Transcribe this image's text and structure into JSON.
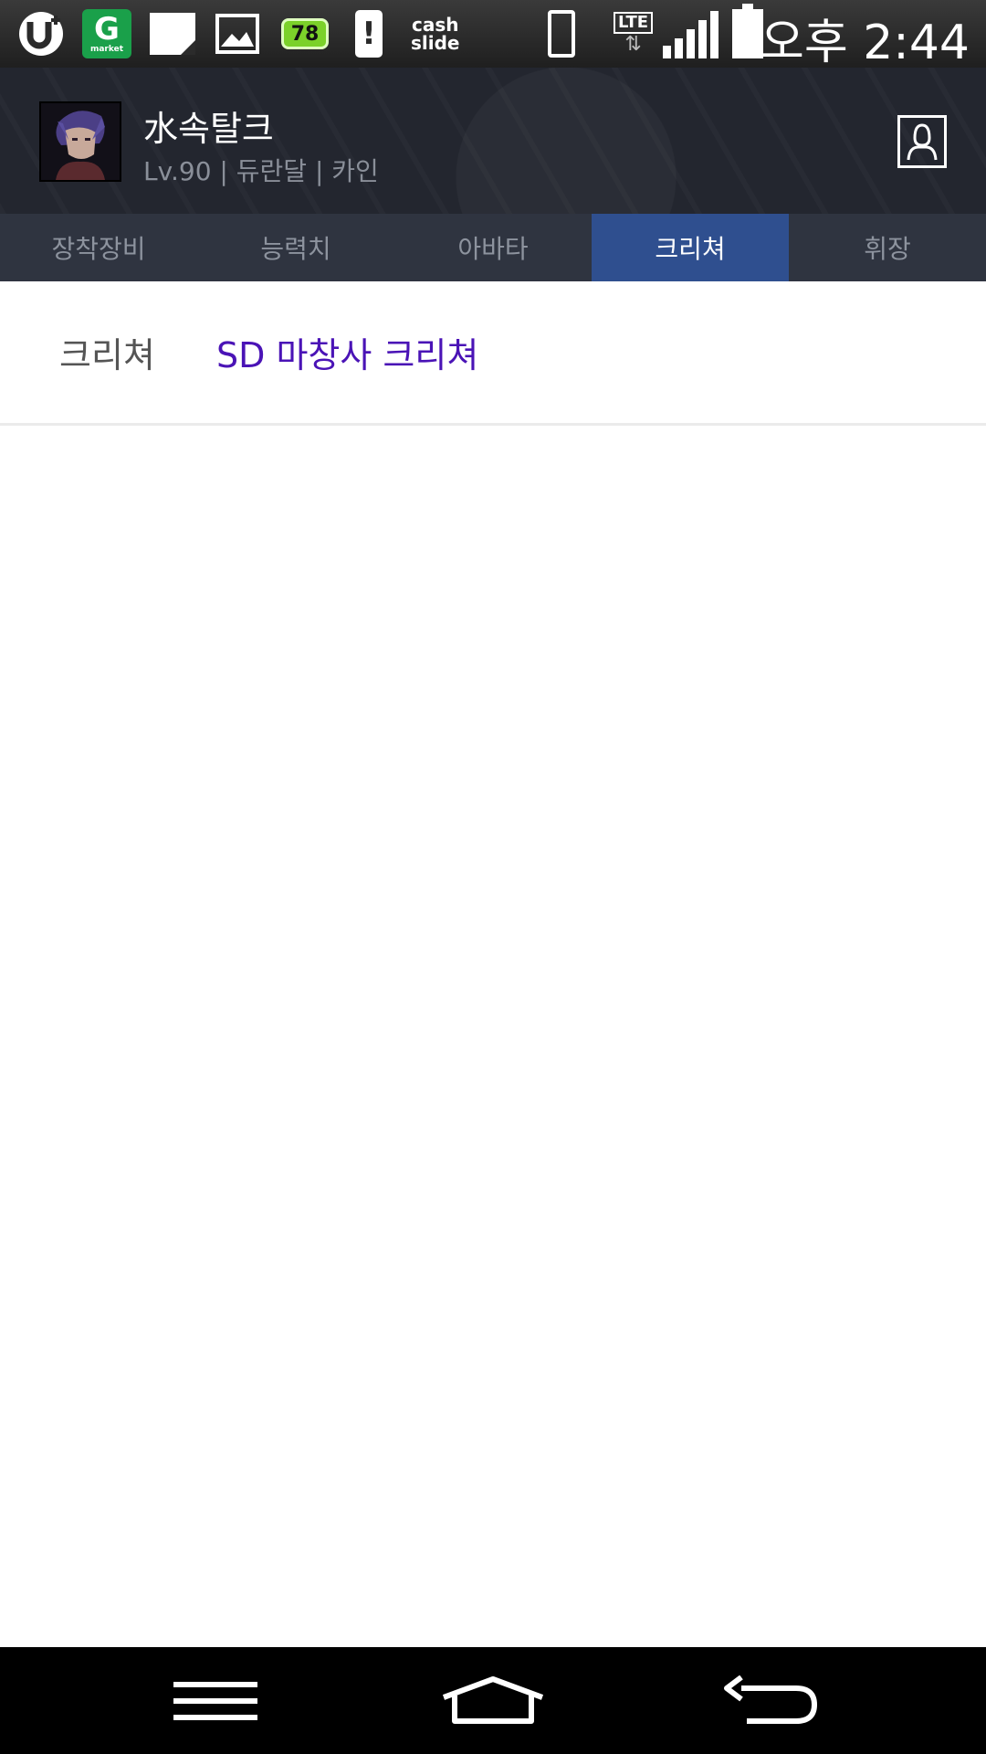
{
  "status_bar": {
    "gmarket_letter": "G",
    "gmarket_label": "market",
    "battery_badge": "78",
    "cashslide_line1": "cash",
    "cashslide_line2": "slide",
    "network_label": "LTE",
    "clock": "오후 2:44",
    "icons": [
      "uplus-icon",
      "gmarket-icon",
      "memo-icon",
      "gallery-icon",
      "battery-saver-icon",
      "battery-alert-icon",
      "cashslide-icon",
      "vibrate-icon",
      "lte-icon",
      "signal-icon",
      "battery-icon"
    ]
  },
  "profile": {
    "name": "水속탈크",
    "info": "Lv.90 | 듀란달 | 카인",
    "action_icon": "person-icon"
  },
  "tabs": [
    {
      "label": "장착장비",
      "active": false
    },
    {
      "label": "능력치",
      "active": false
    },
    {
      "label": "아바타",
      "active": false
    },
    {
      "label": "크리쳐",
      "active": true
    },
    {
      "label": "휘장",
      "active": false
    }
  ],
  "sub_tabs": [
    {
      "label": "크리쳐",
      "selected": false
    },
    {
      "label": "SD 마창사 크리쳐",
      "selected": true
    }
  ],
  "nav_bar": {
    "icons": [
      "menu-icon",
      "home-icon",
      "back-icon"
    ]
  },
  "colors": {
    "active_tab": "#2f4f8f",
    "selected_subtab": "#4a13b6",
    "header_bg": "#23262f"
  }
}
